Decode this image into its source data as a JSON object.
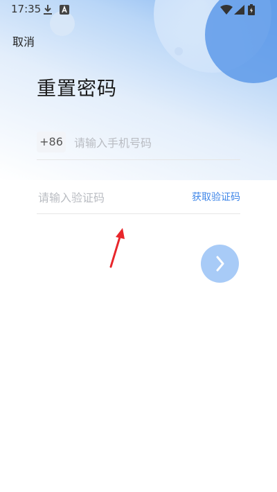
{
  "status_bar": {
    "time": "17:35",
    "icons": [
      "download-icon",
      "a-badge-icon",
      "wifi-icon",
      "signal-icon",
      "battery-icon"
    ]
  },
  "header": {
    "cancel_label": "取消",
    "title": "重置密码"
  },
  "form": {
    "phone": {
      "country_code": "+86",
      "placeholder": "请输入手机号码",
      "value": ""
    },
    "code": {
      "placeholder": "请输入验证码",
      "value": "",
      "get_code_label": "获取验证码"
    },
    "next_button_icon": "chevron-right-icon"
  },
  "colors": {
    "accent": "#3f86e8",
    "next_button": "#a8cbf7",
    "annotation_arrow": "#e8262b",
    "placeholder": "#b9bcc2"
  }
}
